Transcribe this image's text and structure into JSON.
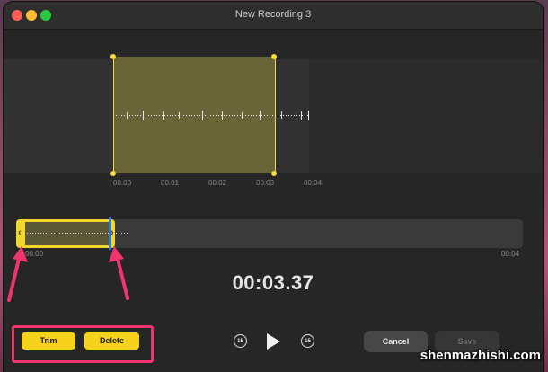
{
  "window": {
    "title": "New Recording 3"
  },
  "editor": {
    "timeline_labels": [
      "00:00",
      "00:01",
      "00:02",
      "00:03",
      "00:04"
    ]
  },
  "overview": {
    "start_label": "00:00",
    "end_label": "00:04"
  },
  "playback": {
    "current_time": "00:03.37"
  },
  "actions": {
    "trim_label": "Trim",
    "delete_label": "Delete",
    "cancel_label": "Cancel",
    "save_label": "Save",
    "skip_back_label": "15",
    "skip_forward_label": "15"
  },
  "watermark": "shenmazhishi.com",
  "colors": {
    "selection_yellow": "#f7d21c",
    "highlight_pink": "#f0346e",
    "playhead_blue": "#2f7bd6"
  }
}
